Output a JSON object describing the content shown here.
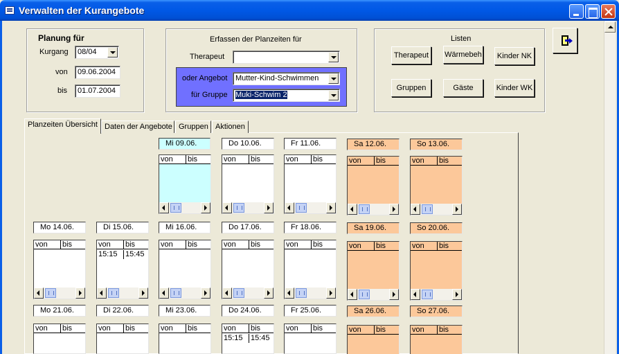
{
  "window": {
    "title": "Verwalten der Kurangebote"
  },
  "planung": {
    "title": "Planung für",
    "kurgang_label": "Kurgang",
    "kurgang_value": "08/04",
    "von_label": "von",
    "von_value": "09.06.2004",
    "bis_label": "bis",
    "bis_value": "01.07.2004"
  },
  "erfassen": {
    "title": "Erfassen der Planzeiten für",
    "therapeut_label": "Therapeut",
    "therapeut_value": "",
    "angebot_label": "oder Angebot",
    "angebot_value": "Mutter-Kind-Schwimmen",
    "gruppe_label": "für Gruppe",
    "gruppe_value": "Muki-Schwim 2"
  },
  "listen": {
    "title": "Listen",
    "buttons": [
      "Therapeut",
      "Wärmebeh",
      "Kinder NK",
      "Gruppen",
      "Gäste",
      "Kinder WK"
    ]
  },
  "tabs": [
    "Planzeiten Übersicht",
    "Daten der Angebote",
    "Gruppen",
    "Aktionen"
  ],
  "columns": {
    "von": "von",
    "bis": "bis"
  },
  "days": [
    {
      "label": "Mi  09.06.",
      "style": "cyan",
      "times": []
    },
    {
      "label": "Do  10.06.",
      "style": "white",
      "times": []
    },
    {
      "label": "Fr  11.06.",
      "style": "white",
      "times": []
    },
    {
      "label": "Sa  12.06.",
      "style": "peach",
      "times": []
    },
    {
      "label": "So  13.06.",
      "style": "peach",
      "times": []
    },
    {
      "label": "Mo  14.06.",
      "style": "white",
      "times": []
    },
    {
      "label": "Di  15.06.",
      "style": "white",
      "times": [
        {
          "von": "15:15",
          "bis": "15:45"
        }
      ]
    },
    {
      "label": "Mi  16.06.",
      "style": "white",
      "times": []
    },
    {
      "label": "Do  17.06.",
      "style": "white",
      "times": []
    },
    {
      "label": "Fr  18.06.",
      "style": "white",
      "times": []
    },
    {
      "label": "Sa  19.06.",
      "style": "peach",
      "times": []
    },
    {
      "label": "So  20.06.",
      "style": "peach",
      "times": []
    },
    {
      "label": "Mo  21.06.",
      "style": "white",
      "times": []
    },
    {
      "label": "Di  22.06.",
      "style": "white",
      "times": []
    },
    {
      "label": "Mi  23.06.",
      "style": "white",
      "times": []
    },
    {
      "label": "Do  24.06.",
      "style": "white",
      "times": [
        {
          "von": "15:15",
          "bis": "15:45"
        }
      ]
    },
    {
      "label": "Fr  25.06.",
      "style": "white",
      "times": []
    },
    {
      "label": "Sa  26.06.",
      "style": "peach",
      "times": []
    },
    {
      "label": "So  27.06.",
      "style": "peach",
      "times": []
    }
  ],
  "colors": {
    "weekday": "#FFFFFF",
    "today": "#CCFFFF",
    "weekend": "#FCC89A",
    "angebot_panel": "#7070FF"
  }
}
